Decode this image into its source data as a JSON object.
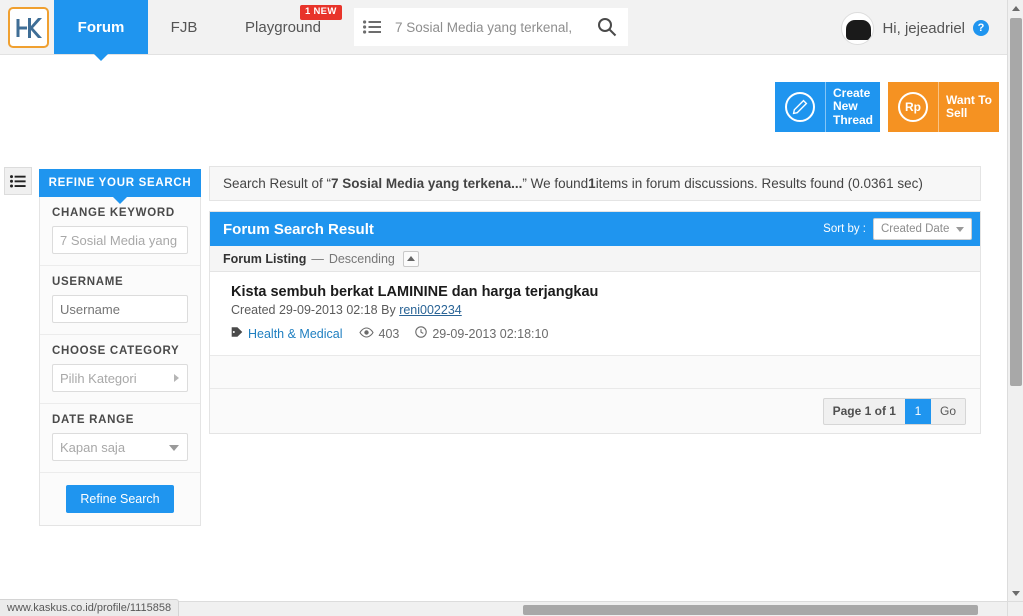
{
  "brand": {
    "logo_icon": "kaskus-k-logo",
    "accent_blue": "#1f95ef",
    "accent_orange": "#f59222",
    "badge_red": "#e8342a"
  },
  "topnav": {
    "tabs": [
      {
        "label": "Forum",
        "active": true,
        "name": "tab-forum"
      },
      {
        "label": "FJB",
        "active": false,
        "name": "tab-fjb"
      },
      {
        "label": "Playground",
        "active": false,
        "name": "tab-playground"
      }
    ],
    "playground_badge": "1 NEW",
    "list_toggle_icon": "list-icon",
    "search": {
      "value": "7 Sosial Media yang terkenal,",
      "placeholder": "7 Sosial Media yang terkenal,",
      "button_icon": "search-icon"
    },
    "user": {
      "greeting": "Hi, jejeadriel",
      "avatar_icon": "user-avatar",
      "help_icon": "question-mark-icon",
      "help_label": "?"
    }
  },
  "actions": [
    {
      "label": "Create\nNew\nThread",
      "icon": "pencil-circle-icon",
      "icon_text": "",
      "name": "create-new-thread-button"
    },
    {
      "label": "Want To\nSell",
      "icon": "rupiah-circle-icon",
      "icon_text": "Rp",
      "name": "want-to-sell-button"
    }
  ],
  "rail": {
    "icon": "list-menu-icon"
  },
  "sidebar": {
    "header": "REFINE YOUR SEARCH",
    "fields": [
      {
        "label": "CHANGE KEYWORD",
        "value": "7 Sosial Media yang",
        "placeholder": "7 Sosial Media yang",
        "type": "text",
        "name": "change-keyword-input"
      },
      {
        "label": "USERNAME",
        "value": "",
        "placeholder": "Username",
        "type": "text",
        "name": "username-input"
      },
      {
        "label": "CHOOSE CATEGORY",
        "value": "Pilih Kategori",
        "type": "select-right",
        "name": "choose-category-select"
      },
      {
        "label": "DATE RANGE",
        "value": "Kapan saja",
        "type": "select-down",
        "name": "date-range-select"
      }
    ],
    "submit_label": "Refine Search"
  },
  "searchinfo": {
    "prefix": "Search Result of “",
    "query": "7 Sosial Media yang terkena...",
    "middle": "” We found ",
    "count": "1",
    "suffix": " items in forum discussions. Results found (0.0361 sec)"
  },
  "result_panel": {
    "title": "Forum Search Result",
    "sort_by_label": "Sort by :",
    "sort_value": "Created Date",
    "listing_label": "Forum Listing",
    "listing_dash": "—",
    "listing_order": "Descending",
    "sort_dir_icon": "caret-up-icon"
  },
  "results": [
    {
      "title": "Kista sembuh berkat LAMININE dan harga terjangkau",
      "created_prefix": "Created 29-09-2013 02:18 By",
      "author": "reni002234",
      "category": "Health & Medical",
      "category_icon": "tag-icon",
      "views": "403",
      "views_icon": "eye-icon",
      "timestamp": "29-09-2013 02:18:10",
      "time_icon": "clock-icon"
    }
  ],
  "pager": {
    "page_text": "Page 1 of 1",
    "current_page": "1",
    "go_label": "Go"
  },
  "browser": {
    "status_text": "www.kaskus.co.id/profile/1115858"
  }
}
